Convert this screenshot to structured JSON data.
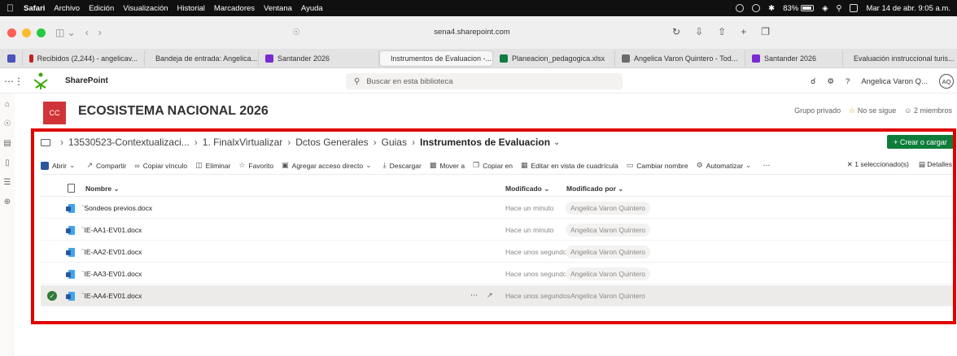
{
  "menubar": {
    "app": "Safari",
    "items": [
      "Archivo",
      "Edición",
      "Visualización",
      "Historial",
      "Marcadores",
      "Ventana",
      "Ayuda"
    ],
    "battery": "83%",
    "datetime": "Mar 14 de abr.  9:05 a.m."
  },
  "browser": {
    "url": "sena4.sharepoint.com",
    "tabs": [
      {
        "label": "Recibidos (2,244) - angelicav...",
        "color": "#c5221f"
      },
      {
        "label": "Bandeja de entrada: Angelica...",
        "color": "#6b6b6b"
      },
      {
        "label": "Santander 2026",
        "color": "#7a2bd1"
      },
      {
        "label": "Instrumentos de Evaluacion -...",
        "color": "#0f7d8a"
      },
      {
        "label": "Planeacion_pedagogica.xlsx",
        "color": "#107c41"
      },
      {
        "label": "Angelica Varon Quintero - Tod...",
        "color": "#6b6b6b"
      },
      {
        "label": "Santander 2026",
        "color": "#7a2bd1"
      },
      {
        "label": "Evaluación instruccional turis...",
        "color": "#888888"
      }
    ]
  },
  "suite": {
    "app_name": "SharePoint",
    "search_placeholder": "Buscar en esta biblioteca",
    "user_name": "Angelica Varon Q...",
    "user_initials": "AQ"
  },
  "site": {
    "logo_initials": "CC",
    "title": "ECOSISTEMA NACIONAL 2026",
    "group": "Grupo privado",
    "follow": "No se sigue",
    "members": "2 miembros"
  },
  "breadcrumb": {
    "items": [
      "13530523-Contextualizaci...",
      "1. FinalxVirtualizar",
      "Dctos Generales",
      "Guias"
    ],
    "current": "Instrumentos de Evaluacion"
  },
  "create_button": "+ Crear o cargar",
  "commands": {
    "open": "Abrir",
    "share": "Compartir",
    "copy_link": "Copiar vínculo",
    "delete": "Eliminar",
    "favorite": "Favorito",
    "shortcut": "Agregar acceso directo",
    "download": "Descargar",
    "move": "Mover a",
    "copy": "Copiar en",
    "grid": "Editar en vista de cuadrícula",
    "rename": "Cambiar nombre",
    "automate": "Automatizar",
    "selected": "1 seleccionado(s)",
    "details": "Detalles"
  },
  "columns": {
    "name": "Nombre",
    "modified": "Modificado",
    "modified_by": "Modificado por"
  },
  "files": [
    {
      "name": "Sondeos previos.docx",
      "modified": "Hace un minuto",
      "by": "Angelica Varon Quintero"
    },
    {
      "name": "IE-AA1-EV01.docx",
      "modified": "Hace un minuto",
      "by": "Angelica Varon Quintero"
    },
    {
      "name": "IE-AA2-EV01.docx",
      "modified": "Hace unos segundos",
      "by": "Angelica Varon Quintero"
    },
    {
      "name": "IE-AA3-EV01.docx",
      "modified": "Hace unos segundos",
      "by": "Angelica Varon Quintero"
    },
    {
      "name": "IE-AA4-EV01.docx",
      "modified": "Hace unos segundos",
      "by": "Angelica Varon Quintero"
    }
  ],
  "colors": {
    "highlight": "#e00000",
    "create": "#0f7d3a",
    "site_logo": "#d13438",
    "word": "#2b579a"
  }
}
